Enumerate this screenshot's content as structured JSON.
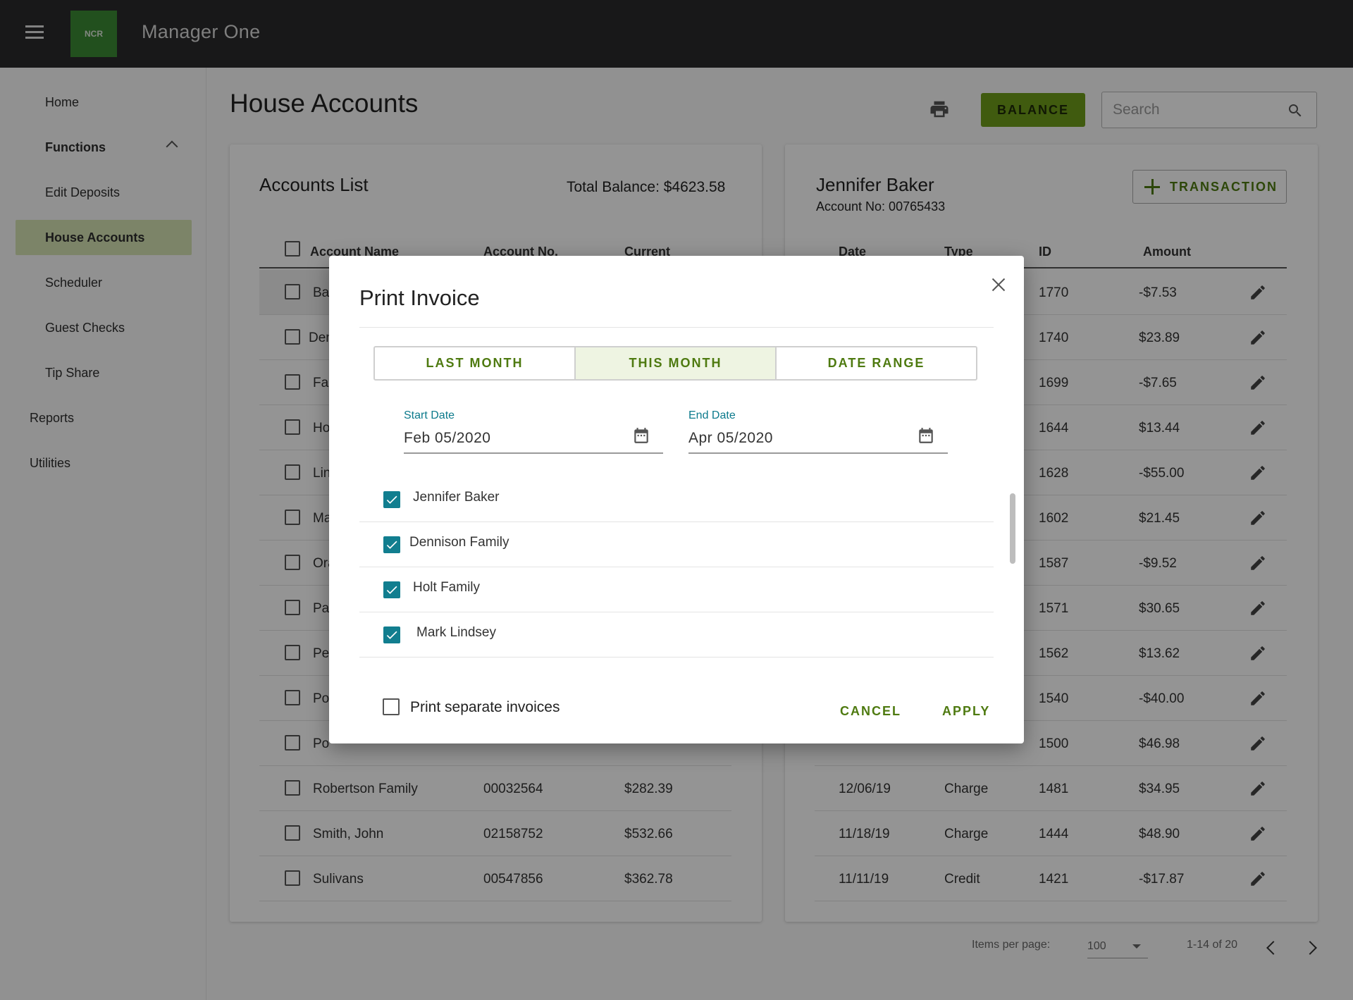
{
  "app": {
    "title": "Manager One",
    "logo_text": "NCR"
  },
  "sidebar": {
    "items": [
      {
        "label": "Home"
      },
      {
        "label": "Functions"
      },
      {
        "label": "Edit Deposits"
      },
      {
        "label": "House Accounts"
      },
      {
        "label": "Scheduler"
      },
      {
        "label": "Guest Checks"
      },
      {
        "label": "Tip Share"
      },
      {
        "label": "Reports"
      },
      {
        "label": "Utilities"
      }
    ]
  },
  "header": {
    "page_title": "House Accounts",
    "balance_label": "BALANCE",
    "search_placeholder": "Search"
  },
  "accounts": {
    "title": "Accounts List",
    "total_balance": "Total Balance: $4623.58",
    "columns": [
      "Account Name",
      "Account No.",
      "Current"
    ],
    "rows": [
      {
        "name": "Ba",
        "no": "",
        "current": ""
      },
      {
        "name": "Den",
        "no": "",
        "current": ""
      },
      {
        "name": "Fa",
        "no": "",
        "current": ""
      },
      {
        "name": "Ho",
        "no": "",
        "current": ""
      },
      {
        "name": "Lin",
        "no": "",
        "current": ""
      },
      {
        "name": "Ma",
        "no": "",
        "current": ""
      },
      {
        "name": "Ora",
        "no": "",
        "current": ""
      },
      {
        "name": "Pa",
        "no": "",
        "current": ""
      },
      {
        "name": "Pe",
        "no": "",
        "current": ""
      },
      {
        "name": "Po",
        "no": "",
        "current": ""
      },
      {
        "name": "Po",
        "no": "",
        "current": ""
      },
      {
        "name": "Robertson Family",
        "no": "00032564",
        "current": "$282.39"
      },
      {
        "name": "Smith, John",
        "no": "02158752",
        "current": "$532.66"
      },
      {
        "name": "Sulivans",
        "no": "00547856",
        "current": "$362.78"
      }
    ]
  },
  "detail": {
    "name": "Jennifer Baker",
    "account_no": "Account No: 00765433",
    "transaction_label": "TRANSACTION",
    "columns": [
      "Date",
      "Type",
      "ID",
      "Amount"
    ],
    "rows": [
      {
        "date": "",
        "type": "",
        "id": "1770",
        "amount": "-$7.53"
      },
      {
        "date": "",
        "type": "",
        "id": "1740",
        "amount": "$23.89"
      },
      {
        "date": "",
        "type": "",
        "id": "1699",
        "amount": "-$7.65"
      },
      {
        "date": "",
        "type": "",
        "id": "1644",
        "amount": "$13.44"
      },
      {
        "date": "",
        "type": "",
        "id": "1628",
        "amount": "-$55.00"
      },
      {
        "date": "",
        "type": "",
        "id": "1602",
        "amount": "$21.45"
      },
      {
        "date": "",
        "type": "",
        "id": "1587",
        "amount": "-$9.52"
      },
      {
        "date": "",
        "type": "",
        "id": "1571",
        "amount": "$30.65"
      },
      {
        "date": "",
        "type": "",
        "id": "1562",
        "amount": "$13.62"
      },
      {
        "date": "",
        "type": "",
        "id": "1540",
        "amount": "-$40.00"
      },
      {
        "date": "",
        "type": "",
        "id": "1500",
        "amount": "$46.98"
      },
      {
        "date": "12/06/19",
        "type": "Charge",
        "id": "1481",
        "amount": "$34.95"
      },
      {
        "date": "11/18/19",
        "type": "Charge",
        "id": "1444",
        "amount": "$48.90"
      },
      {
        "date": "11/11/19",
        "type": "Credit",
        "id": "1421",
        "amount": "-$17.87"
      }
    ]
  },
  "pagination": {
    "items_per_page_label": "Items per page:",
    "items_per_page": "100",
    "range": "1-14 of 20"
  },
  "dialog": {
    "title": "Print Invoice",
    "tabs": [
      "LAST MONTH",
      "THIS MONTH",
      "DATE RANGE"
    ],
    "selected_tab": "THIS MONTH",
    "start_label": "Start Date",
    "start_value": "Feb 05/2020",
    "end_label": "End Date",
    "end_value": "Apr 05/2020",
    "accounts": [
      {
        "label": "Jennifer Baker",
        "checked": true
      },
      {
        "label": "Dennison Family",
        "checked": true
      },
      {
        "label": "Holt Family",
        "checked": true
      },
      {
        "label": "Mark Lindsey",
        "checked": true
      }
    ],
    "separate_label": "Print separate invoices",
    "separate_checked": false,
    "cancel_label": "CANCEL",
    "apply_label": "APPLY"
  },
  "colors": {
    "accent": "#6e9d1a",
    "teal": "#117e8f",
    "topbar": "#2a2a2b",
    "active_nav": "#d6e4b4"
  }
}
